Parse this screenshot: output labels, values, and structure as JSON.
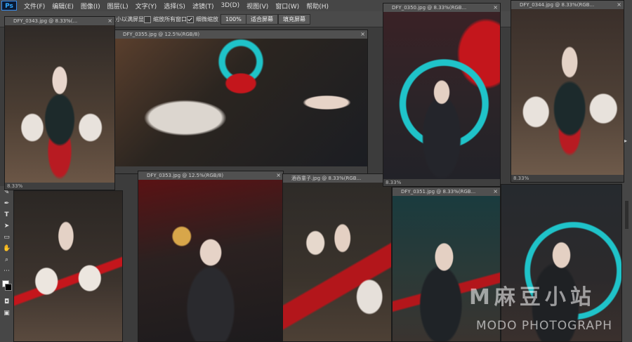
{
  "app": {
    "logo": "Ps",
    "menu": [
      "文件(F)",
      "编辑(E)",
      "图像(I)",
      "图层(L)",
      "文字(Y)",
      "选择(S)",
      "滤镜(T)",
      "3D(D)",
      "视图(V)",
      "窗口(W)",
      "帮助(H)"
    ]
  },
  "options": {
    "checks": [
      {
        "label": "调整窗口大小以满屏显示"
      },
      {
        "label": "缩放所有窗口"
      },
      {
        "label": "细微缩放"
      }
    ],
    "zoom_value": "100%",
    "fit_screen": "适合屏幕",
    "fill_screen": "填充屏幕"
  },
  "documents": [
    {
      "title": "DFY_0343.jpg @ 8.33%(...",
      "zoom": "8.33%"
    },
    {
      "title": "DFY_0355.jpg @ 12.5%(RGB/8)"
    },
    {
      "title": "DFY_0350.jpg @ 8.33%(RGB...",
      "zoom": "8.33%"
    },
    {
      "title": "DFY_0344.jpg @ 8.33%(RGB...",
      "zoom": "8.33%"
    },
    {
      "title": "DFY_0353.jpg @ 12.5%(RGB/8)"
    },
    {
      "title": "酒吞童子.jpg @ 8.33%(RGB..."
    },
    {
      "title": "DFY_0351.jpg @ 8.33%(RGB..."
    }
  ],
  "close_symbol": "×",
  "watermark": {
    "brand": "M麻豆小站",
    "sub": "MODO PHOTOGRAPH"
  },
  "colors": {
    "accent_teal": "#1fc3c9",
    "accent_red": "#c4161c"
  }
}
